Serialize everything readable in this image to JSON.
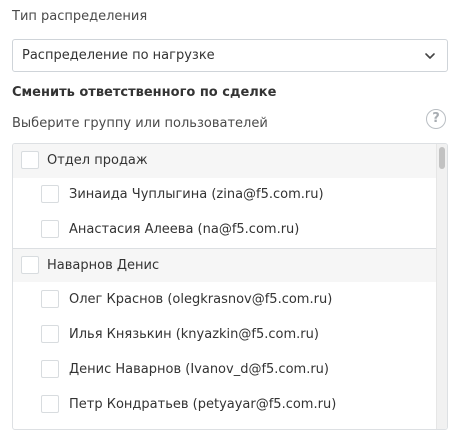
{
  "distribution": {
    "label": "Тип распределения",
    "selected": "Распределение по нагрузке"
  },
  "section_title": "Сменить ответственного по сделке",
  "hint": "Выберите группу или пользователей",
  "help_icon": "?",
  "list": {
    "items": [
      {
        "type": "group",
        "label": "Отдел продаж",
        "checked": false
      },
      {
        "type": "user",
        "label": "Зинаида Чуплыгина (zina@f5.com.ru)",
        "checked": false
      },
      {
        "type": "user",
        "label": "Анастасия Алеева (na@f5.com.ru)",
        "checked": false
      },
      {
        "type": "group",
        "label": "Наварнов Денис",
        "checked": false
      },
      {
        "type": "user",
        "label": "Олег Краснов (olegkrasnov@f5.com.ru)",
        "checked": false
      },
      {
        "type": "user",
        "label": "Илья Князькин (knyazkin@f5.com.ru)",
        "checked": false
      },
      {
        "type": "user",
        "label": "Денис Наварнов (Ivanov_d@f5.com.ru)",
        "checked": false
      },
      {
        "type": "user",
        "label": "Петр Кондратьев (petyayar@f5.com.ru)",
        "checked": false
      }
    ]
  }
}
